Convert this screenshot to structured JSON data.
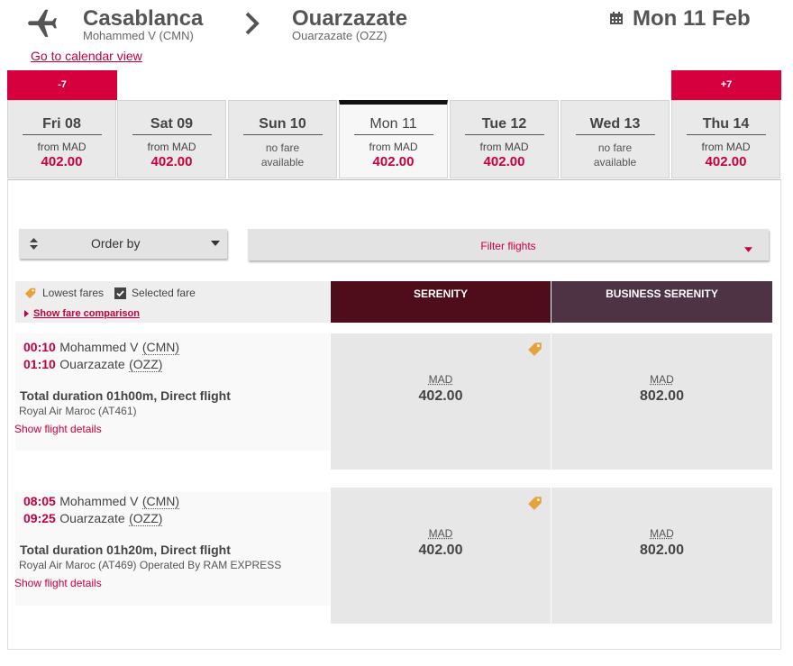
{
  "header": {
    "origin_city": "Casablanca",
    "origin_airport": "Mohammed V (CMN)",
    "dest_city": "Ouarzazate",
    "dest_airport": "Ouarzazate (OZZ)",
    "date": "Mon 11 Feb",
    "calendar_link": "Go to calendar view"
  },
  "nav": {
    "prev": "-7",
    "next": "+7"
  },
  "days": [
    {
      "name": "Fri 08",
      "from": "from MAD",
      "price": "402.00"
    },
    {
      "name": "Sat 09",
      "from": "from MAD",
      "price": "402.00"
    },
    {
      "name": "Sun 10",
      "nofare1": "no fare",
      "nofare2": "available"
    },
    {
      "name": "Mon 11",
      "from": "from MAD",
      "price": "402.00"
    },
    {
      "name": "Tue 12",
      "from": "from MAD",
      "price": "402.00"
    },
    {
      "name": "Wed 13",
      "nofare1": "no fare",
      "nofare2": "available"
    },
    {
      "name": "Thu 14",
      "from": "from MAD",
      "price": "402.00"
    }
  ],
  "toolbar": {
    "order_by": "Order by",
    "filter": "Filter flights"
  },
  "legend": {
    "lowest": "Lowest fares",
    "selected": "Selected fare",
    "compare": "Show fare comparison"
  },
  "cabins": [
    {
      "name": "SERENITY",
      "color": "#4f0c1a"
    },
    {
      "name": "BUSINESS SERENITY",
      "color": "#4d3343"
    }
  ],
  "colors": {
    "accent": "#c6003c",
    "nav": "#d5003d",
    "tag": "#e6a23c"
  },
  "flights": [
    {
      "dep_time": "00:10",
      "dep_place": "Mohammed V",
      "dep_code": "(CMN)",
      "arr_time": "01:10",
      "arr_place": "Ouarzazate",
      "arr_code": "(OZZ)",
      "duration": "Total duration 01h00m, Direct flight",
      "airline": "Royal Air Maroc (AT461)",
      "details": "Show flight details",
      "fares": [
        {
          "currency": "MAD",
          "amount": "402.00"
        },
        {
          "currency": "MAD",
          "amount": "802.00"
        }
      ]
    },
    {
      "dep_time": "08:05",
      "dep_place": "Mohammed V",
      "dep_code": "(CMN)",
      "arr_time": "09:25",
      "arr_place": "Ouarzazate",
      "arr_code": "(OZZ)",
      "duration": "Total duration 01h20m, Direct flight",
      "airline": "Royal Air Maroc (AT469) Operated By RAM EXPRESS",
      "details": "Show flight details",
      "fares": [
        {
          "currency": "MAD",
          "amount": "402.00"
        },
        {
          "currency": "MAD",
          "amount": "802.00"
        }
      ]
    }
  ]
}
